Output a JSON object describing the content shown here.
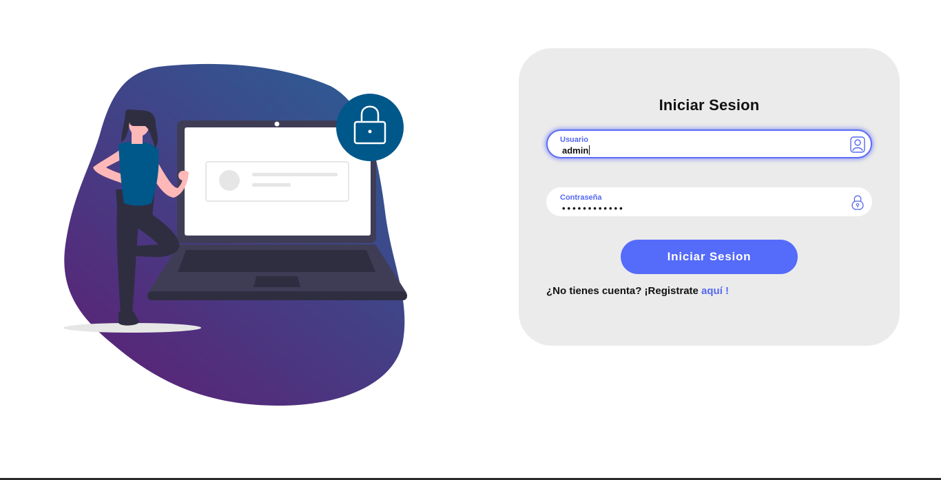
{
  "login": {
    "title": "Iniciar Sesion",
    "username": {
      "label": "Usuario",
      "value": "admin",
      "icon": "user-icon"
    },
    "password": {
      "label": "Contraseña",
      "masked_value": "••••••••••••",
      "icon": "lock-icon"
    },
    "submit_label": "Iniciar Sesion",
    "register_prompt": "¿No tienes cuenta? ¡Registrate ",
    "register_link": "aquí !"
  },
  "colors": {
    "accent": "#556bfa",
    "card_background": "#ebebeb",
    "blob_top": "#2f5a93",
    "blob_bottom": "#5a2377",
    "lock_badge": "#00578a",
    "laptop": "#3f3d56"
  }
}
